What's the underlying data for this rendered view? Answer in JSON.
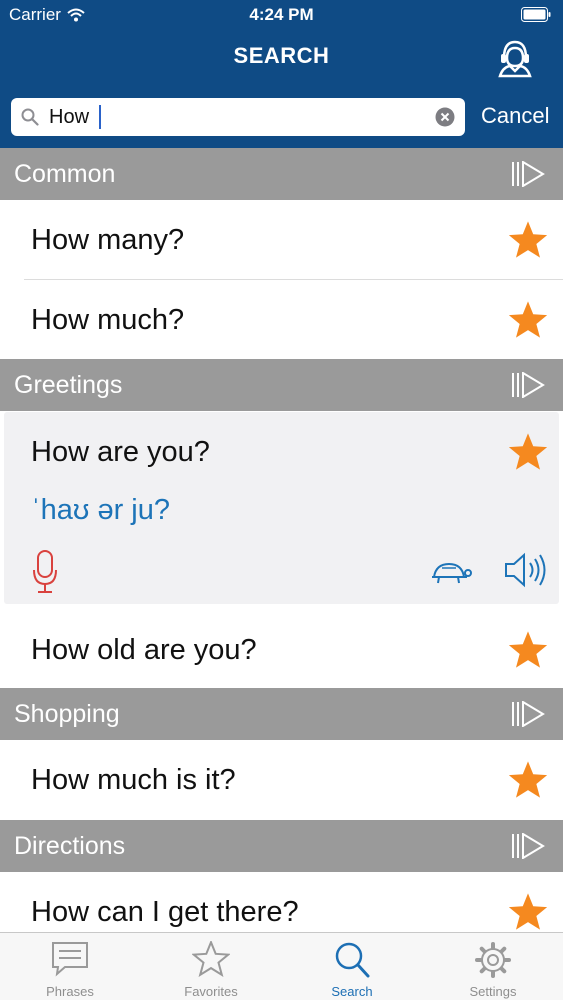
{
  "status_bar": {
    "carrier": "Carrier",
    "time": "4:24 PM"
  },
  "header": {
    "title": "SEARCH",
    "agent_icon": "customer-service-icon"
  },
  "search": {
    "value": "How",
    "cancel_label": "Cancel"
  },
  "sections": [
    {
      "label": "Common",
      "rows": [
        "How many?",
        "How much?"
      ]
    },
    {
      "label": "Greetings",
      "rows": [
        "How are you?",
        "How old are you?"
      ]
    },
    {
      "label": "Shopping",
      "rows": [
        "How much is it?"
      ]
    },
    {
      "label": "Directions",
      "rows": [
        "How can I get there?"
      ]
    }
  ],
  "expanded_item": {
    "phrase": "How are you?",
    "pronunciation": "ˈhaʊ ər ju?"
  },
  "colors": {
    "header": "#0f4b85",
    "star": "#f5891f",
    "section": "#9a9a9a",
    "active_tab": "#1d6fb4",
    "mic": "#d9423e",
    "pronunciation": "#1d74b8"
  },
  "tabs": [
    {
      "label": "Phrases",
      "icon": "speech-bubble-icon",
      "active": false
    },
    {
      "label": "Favorites",
      "icon": "star-outline-icon",
      "active": false
    },
    {
      "label": "Search",
      "icon": "search-icon",
      "active": true
    },
    {
      "label": "Settings",
      "icon": "gear-icon",
      "active": false
    }
  ]
}
